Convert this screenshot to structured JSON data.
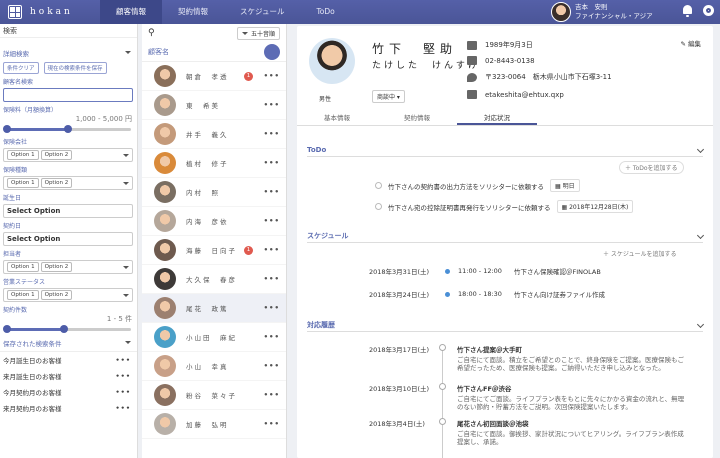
{
  "app": {
    "logo": "hokan"
  },
  "nav": [
    "顧客情報",
    "契約情報",
    "スケジュール",
    "ToDo"
  ],
  "user": {
    "name": "吉本　安則",
    "org": "ファイナンシャル・アジア"
  },
  "filter": {
    "title": "検索",
    "detail_search": "詳細検索",
    "clear_btn": "条件クリア",
    "save_btn": "現在の検索条件を保存",
    "customer_search": "顧客名検索",
    "premium_label": "保険料（月額換算）",
    "premium_range": "1,000 - 5,000 円",
    "insurer_label": "保険会社",
    "type_label": "保険種類",
    "birthday_label": "誕生日",
    "contract_date_label": "契約日",
    "select_option": "Select Option",
    "staff_label": "担当者",
    "sales_status_label": "営業ステータス",
    "contracts_label": "契約件数",
    "contracts_range": "1 - 5 件",
    "opt1": "Option 1",
    "opt2": "Option 2",
    "saved_title": "保存された検索条件",
    "saved": [
      "今月誕生日のお客様",
      "来月誕生日のお客様",
      "今月契約月のお客様",
      "来月契約月のお客様"
    ]
  },
  "list": {
    "sort": "五十音順",
    "header": "顧客名",
    "customers": [
      {
        "name": "朝倉　孝透",
        "badge": "1",
        "face": "#8a6f5a"
      },
      {
        "name": "東　希美",
        "badge": "",
        "face": "#a99a8c"
      },
      {
        "name": "井手　義久",
        "badge": "",
        "face": "#c49a7a"
      },
      {
        "name": "植村　修子",
        "badge": "",
        "face": "#d98a3a"
      },
      {
        "name": "内村　照",
        "badge": "",
        "face": "#7a6e62"
      },
      {
        "name": "内海　彦依",
        "badge": "",
        "face": "#b5a79a"
      },
      {
        "name": "海藤　日向子",
        "badge": "1",
        "face": "#6e5a4e"
      },
      {
        "name": "大久保　春彦",
        "badge": "",
        "face": "#3e3a38"
      },
      {
        "name": "尾花　政篤",
        "badge": "",
        "face": "#9c8070"
      },
      {
        "name": "小山田　麻紀",
        "badge": "",
        "face": "#4aa0c8"
      },
      {
        "name": "小山　幸真",
        "badge": "",
        "face": "#c8a088"
      },
      {
        "name": "粉谷　菜々子",
        "badge": "",
        "face": "#8a7060"
      },
      {
        "name": "加藤　弘明",
        "badge": "",
        "face": "#b8b0a8"
      }
    ]
  },
  "profile": {
    "name": "竹下　堅助",
    "kana": "たけした　けんすけ",
    "gender": "男性",
    "status": "商談中",
    "birthday": "1989年9月3日",
    "phone": "02-8443-0138",
    "address": "〒323-0064　栃木県小山市下石塚3-11",
    "email": "etakeshita@ehtux.qxp",
    "edit": "編集"
  },
  "tabs": [
    "基本情報",
    "契約情報",
    "対応状況"
  ],
  "todo": {
    "title": "ToDo",
    "add": "ToDoを追加する",
    "items": [
      {
        "text": "竹下さんの契約書の出力方法をソリシターに依頼する",
        "date": "明日"
      },
      {
        "text": "竹下さん宛の控除証明書再発行をソリシターに依頼する",
        "date": "2018年12月28日(木)"
      }
    ]
  },
  "schedule": {
    "title": "スケジュール",
    "add": "スケジュールを追加する",
    "items": [
      {
        "date": "2018年3月31日(土)",
        "time": "11:00 - 12:00",
        "text": "竹下さん保険確認＠FINOLAB"
      },
      {
        "date": "2018年3月24日(土)",
        "time": "18:00 - 18:30",
        "text": "竹下さん向け証券ファイル作成"
      }
    ]
  },
  "history": {
    "title": "対応履歴",
    "items": [
      {
        "date": "2018年3月17日(土)",
        "title": "竹下さん提案＠大手町",
        "body": "ご自宅にて面談。積立をご希望とのことで、終身保険をご提案。医療保険もご希望だったため、医療保険も提案。ご納得いただき申し込みとなった。"
      },
      {
        "date": "2018年3月10日(土)",
        "title": "竹下さんFF＠渋谷",
        "body": "ご自宅にてご面談。ライフプラン表をもとに先々にかかる資金の流れと、無理のない節約・貯蓄方法をご説明。次回保険提案いたします。"
      },
      {
        "date": "2018年3月4日(土)",
        "title": "尾花さん初回面談＠池袋",
        "body": "ご自宅にて面談。御挨拶、家計状況についてヒアリング。ライフプラン表作成提案し、承諾。"
      }
    ]
  }
}
